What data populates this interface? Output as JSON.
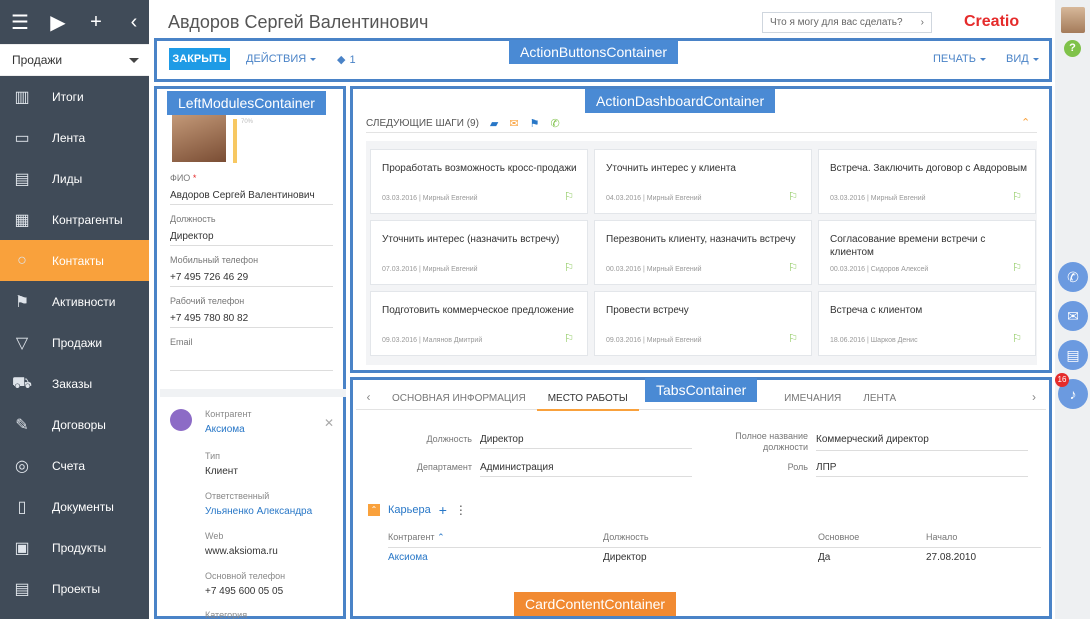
{
  "sidebar": {
    "workplace": "Продажи",
    "items": [
      {
        "label": "Итоги",
        "icon": "bar-chart-icon"
      },
      {
        "label": "Лента",
        "icon": "feed-icon"
      },
      {
        "label": "Лиды",
        "icon": "leads-icon"
      },
      {
        "label": "Контрагенты",
        "icon": "accounts-icon"
      },
      {
        "label": "Контакты",
        "icon": "contact-icon"
      },
      {
        "label": "Активности",
        "icon": "flag-icon"
      },
      {
        "label": "Продажи",
        "icon": "funnel-icon"
      },
      {
        "label": "Заказы",
        "icon": "cart-icon"
      },
      {
        "label": "Договоры",
        "icon": "contract-icon"
      },
      {
        "label": "Счета",
        "icon": "coins-icon"
      },
      {
        "label": "Документы",
        "icon": "document-icon"
      },
      {
        "label": "Продукты",
        "icon": "products-icon"
      },
      {
        "label": "Проекты",
        "icon": "projects-icon"
      }
    ]
  },
  "header": {
    "title": "Авдоров Сергей Валентинович",
    "search_placeholder": "Что я могу для вас сделать?",
    "logo": "Creatio"
  },
  "actions": {
    "close": "ЗАКРЫТЬ",
    "actions": "ДЕЙСТВИЯ",
    "tag_count": "1",
    "print": "ПЕЧАТЬ",
    "view": "ВИД"
  },
  "containers": {
    "action_buttons": "ActionButtonsContainer",
    "left_modules": "LeftModulesContainer",
    "action_dashboard": "ActionDashboardContainer",
    "tabs": "TabsContainer",
    "card_content": "CardContentContainer"
  },
  "profile": {
    "fill_percent": "70%",
    "fio_label": "ФИО",
    "fio_value": "Авдоров Сергей Валентинович",
    "position_label": "Должность",
    "position_value": "Директор",
    "mobile_label": "Мобильный телефон",
    "mobile_value": "+7 495 726 46 29",
    "work_phone_label": "Рабочий телефон",
    "work_phone_value": "+7 495 780 80 82",
    "email_label": "Email"
  },
  "account": {
    "account_label": "Контрагент",
    "account_value": "Аксиома",
    "type_label": "Тип",
    "type_value": "Клиент",
    "owner_label": "Ответственный",
    "owner_value": "Ульяненко Александра",
    "web_label": "Web",
    "web_value": "www.aksioma.ru",
    "phone_label": "Основной телефон",
    "phone_value": "+7 495 600 05 05",
    "category_label": "Категория"
  },
  "dashboard": {
    "title": "СЛЕДУЮЩИЕ ШАГИ (9)",
    "cards": [
      {
        "title": "Проработать возможность кросс-продажи",
        "date": "03.03.2016",
        "person": "Мирный Евгений"
      },
      {
        "title": "Уточнить интерес у клиента",
        "date": "04.03.2016",
        "person": "Мирный Евгений"
      },
      {
        "title": "Встреча. Заключить договор с Авдоровым",
        "date": "03.03.2016",
        "person": "Мирный Евгений"
      },
      {
        "title": "Уточнить интерес (назначить встречу)",
        "date": "07.03.2016",
        "person": "Мирный Евгений"
      },
      {
        "title": "Перезвонить клиенту, назначить встречу",
        "date": "00.03.2016",
        "person": "Мирный Евгений"
      },
      {
        "title": "Согласование времени встречи с клиентом",
        "date": "00.03.2016",
        "person": "Сидоров Алексей"
      },
      {
        "title": "Подготовить коммерческое предложение",
        "date": "09.03.2016",
        "person": "Малянов Дмитрий"
      },
      {
        "title": "Провести встречу",
        "date": "09.03.2016",
        "person": "Мирный Евгений"
      },
      {
        "title": "Встреча с клиентом",
        "date": "18.06.2016",
        "person": "Шарков Денис"
      }
    ]
  },
  "tabs": {
    "items": [
      "ОСНОВНАЯ ИНФОРМАЦИЯ",
      "МЕСТО РАБОТЫ",
      "ИС",
      "ИМЕЧАНИЯ",
      "ЛЕНТА"
    ]
  },
  "job": {
    "position_label": "Должность",
    "position_value": "Директор",
    "department_label": "Департамент",
    "department_value": "Администрация",
    "full_title_label_1": "Полное название",
    "full_title_label_2": "должности",
    "full_title_value": "Коммерческий директор",
    "role_label": "Роль",
    "role_value": "ЛПР"
  },
  "career": {
    "title": "Карьера",
    "columns": [
      "Контрагент",
      "Должность",
      "Основное",
      "Начало"
    ],
    "rows": [
      {
        "account": "Аксиома",
        "position": "Директор",
        "primary": "Да",
        "start": "27.08.2010"
      }
    ]
  },
  "notifications": {
    "count": "16"
  }
}
